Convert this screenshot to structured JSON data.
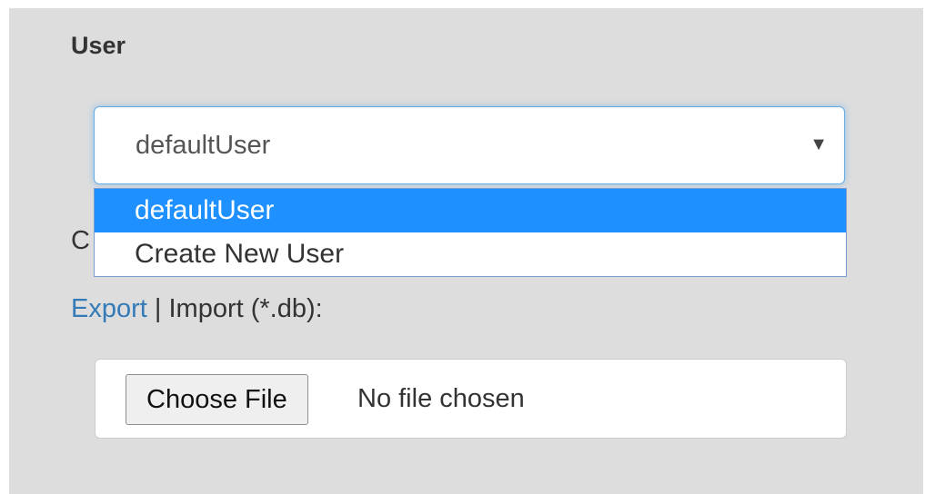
{
  "section": {
    "title": "User"
  },
  "user_select": {
    "value": "defaultUser",
    "caret": "▼",
    "options": [
      {
        "label": "defaultUser",
        "selected": true
      },
      {
        "label": "Create New User",
        "selected": false
      }
    ]
  },
  "hidden_label_partial": "C",
  "export_row": {
    "export_link": "Export",
    "separator": " | ",
    "import_text": "Import (*.db):"
  },
  "file_input": {
    "button_label": "Choose File",
    "status": "No file chosen"
  },
  "colors": {
    "panel_bg": "#dddddd",
    "selected_option_bg": "#1e90ff",
    "link": "#337ab7",
    "focus_border": "#66afe9"
  }
}
